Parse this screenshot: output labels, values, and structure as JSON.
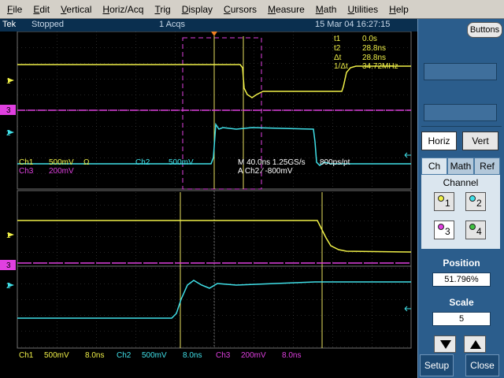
{
  "menu": {
    "items": [
      {
        "u": "F",
        "rest": "ile"
      },
      {
        "u": "E",
        "rest": "dit"
      },
      {
        "u": "V",
        "rest": "ertical"
      },
      {
        "u": "H",
        "rest": "oriz/Acq"
      },
      {
        "u": "T",
        "rest": "rig"
      },
      {
        "u": "D",
        "rest": "isplay"
      },
      {
        "u": "C",
        "rest": "ursors"
      },
      {
        "u": "M",
        "rest": "easure"
      },
      {
        "u": "M",
        "rest": "ath"
      },
      {
        "u": "U",
        "rest": "tilities"
      },
      {
        "u": "H",
        "rest": "elp"
      }
    ]
  },
  "status": {
    "brand": "Tek",
    "state": "Stopped",
    "acqs": "1 Acqs",
    "datetime": "15 Mar 04 16:27:15"
  },
  "cursor_readout": {
    "t1_label": "t1",
    "t1_value": "0.0s",
    "t2_label": "t2",
    "t2_value": "28.8ns",
    "dt_label": "Δt",
    "dt_value": "28.8ns",
    "inv_label": "1/Δt",
    "inv_value": "34.72MHz"
  },
  "upper_readout": {
    "ch1": "Ch1",
    "ch1_scale": "500mV",
    "ch1_coupling": "Ω",
    "ch2": "Ch2",
    "ch2_scale": "500mV",
    "ch3": "Ch3",
    "ch3_scale": "200mV",
    "timebase": "M 40.0ns 1.25GS/s",
    "record": "800ps/pt",
    "trigger": "A  Ch2  ∕  -800mV"
  },
  "markers": {
    "ch1": "1",
    "ch2": "2",
    "ch3": "3"
  },
  "zoom_readout": {
    "ch1": "Ch1",
    "ch1_scale": "500mV",
    "ch1_time": "8.0ns",
    "ch2": "Ch2",
    "ch2_scale": "500mV",
    "ch2_time": "8.0ns",
    "ch3": "Ch3",
    "ch3_scale": "200mV",
    "ch3_time": "8.0ns"
  },
  "colors": {
    "ch1": "#f0f048",
    "ch2": "#40e0e8",
    "ch3": "#e040e0",
    "grid": "#5a5a5a",
    "cursor": "#e8e060",
    "panel": "#2b5d8c"
  },
  "panel": {
    "buttons_label": "Buttons",
    "horiz_label": "Horiz",
    "vert_label": "Vert",
    "tab_ch": "Ch",
    "tab_math": "Math",
    "tab_ref": "Ref",
    "channel_label": "Channel",
    "channels": [
      {
        "num": "1",
        "color": "#f0f048",
        "selected": false
      },
      {
        "num": "2",
        "color": "#40e0e8",
        "selected": false
      },
      {
        "num": "3",
        "color": "#e040e0",
        "selected": true
      },
      {
        "num": "4",
        "color": "#40c040",
        "selected": false
      }
    ],
    "position_label": "Position",
    "position_value": "51.796%",
    "scale_label": "Scale",
    "scale_value": "5",
    "down_icon": "triangle-down-icon",
    "up_icon": "triangle-up-icon",
    "setup_label": "Setup",
    "close_label": "Close"
  }
}
